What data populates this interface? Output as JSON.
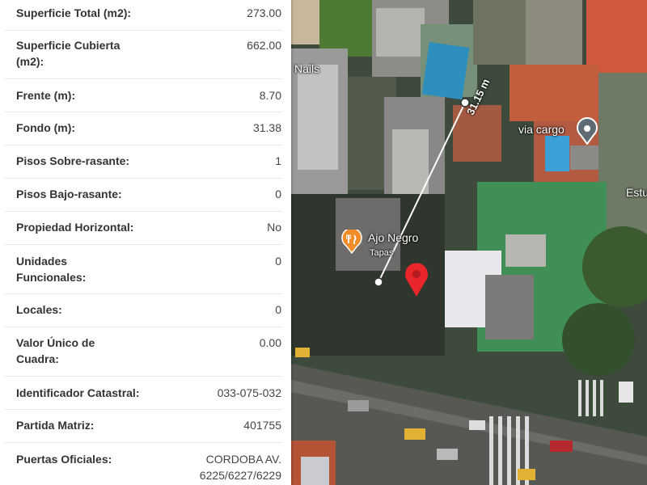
{
  "details": {
    "superficie_total": {
      "label": "Superficie Total (m2):",
      "value": "273.00"
    },
    "superficie_cubierta": {
      "label_line1": "Superficie Cubierta",
      "label_line2": "(m2):",
      "value": "662.00"
    },
    "frente": {
      "label": "Frente (m):",
      "value": "8.70"
    },
    "fondo": {
      "label": "Fondo (m):",
      "value": "31.38"
    },
    "pisos_sobre": {
      "label": "Pisos Sobre-rasante:",
      "value": "1"
    },
    "pisos_bajo": {
      "label": "Pisos Bajo-rasante:",
      "value": "0"
    },
    "propiedad_horizontal": {
      "label": "Propiedad Horizontal:",
      "value": "No"
    },
    "unidades_funcionales": {
      "label_line1": "Unidades",
      "label_line2": "Funcionales:",
      "value": "0"
    },
    "locales": {
      "label": "Locales:",
      "value": "0"
    },
    "valor_unico": {
      "label_line1": "Valor Único de",
      "label_line2": "Cuadra:",
      "value": "0.00"
    },
    "identificador_catastral": {
      "label": "Identificador Catastral:",
      "value": "033-075-032"
    },
    "partida_matriz": {
      "label": "Partida Matriz:",
      "value": "401755"
    },
    "puertas_oficiales": {
      "label": "Puertas Oficiales:",
      "value_line1": "CORDOBA AV.",
      "value_line2": "6225/6227/6229"
    }
  },
  "map": {
    "labels": {
      "nails": "Nails",
      "via_cargo": "via cargo",
      "ajo_negro": "Ajo Negro",
      "ajo_negro_sub": "Tapas",
      "estu": "Estu"
    },
    "measurement": "31.15 m",
    "icons": [
      "fork-knife-icon",
      "map-pin-icon",
      "place-marker-icon"
    ],
    "colors": {
      "marker": "#e8262c",
      "restaurant": "#f28c28"
    }
  }
}
